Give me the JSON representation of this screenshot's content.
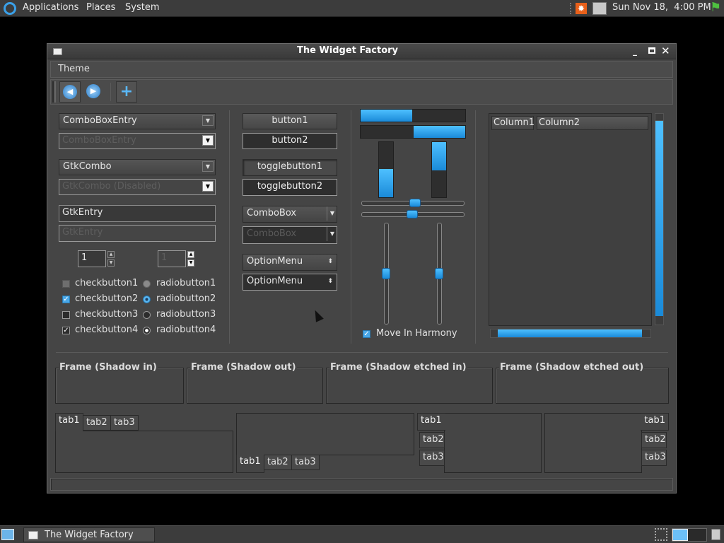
{
  "top_panel": {
    "menus": [
      "Applications",
      "Places",
      "System"
    ],
    "clock": "Sun Nov 18,  4:00 PM"
  },
  "window": {
    "title": "The Widget Factory",
    "menu": [
      "Theme"
    ],
    "combos": {
      "combo_entry": "ComboBoxEntry",
      "combo_entry_disabled": "ComboBoxEntry",
      "gtk_combo": "GtkCombo",
      "gtk_combo_disabled": "GtkCombo (Disabled)"
    },
    "entries": {
      "entry": "GtkEntry",
      "entry_disabled": "GtkEntry"
    },
    "spin_values": [
      "1",
      "1"
    ],
    "checks": [
      {
        "label": "checkbutton1",
        "state": "inconsistent"
      },
      {
        "label": "checkbutton2",
        "state": "checked-disabled"
      },
      {
        "label": "checkbutton3",
        "state": "unchecked"
      },
      {
        "label": "checkbutton4",
        "state": "checked"
      }
    ],
    "radios": [
      {
        "label": "radiobutton1",
        "state": "inconsistent"
      },
      {
        "label": "radiobutton2",
        "state": "checked-disabled"
      },
      {
        "label": "radiobutton3",
        "state": "unchecked"
      },
      {
        "label": "radiobutton4",
        "state": "checked"
      }
    ],
    "buttons": [
      "button1",
      "button2"
    ],
    "toggles": [
      "togglebutton1",
      "togglebutton2"
    ],
    "comboboxes": [
      "ComboBox",
      "ComboBox"
    ],
    "option_menus": [
      "OptionMenu",
      "OptionMenu"
    ],
    "progress": {
      "h1": 0.49,
      "h2": 0.49,
      "v1": 0.5,
      "v2": 0.5
    },
    "harmony_label": "Move In Harmony",
    "tree_columns": [
      "Column1",
      "Column2"
    ],
    "frames": [
      "Frame (Shadow in)",
      "Frame (Shadow out)",
      "Frame (Shadow etched in)",
      "Frame (Shadow etched out)"
    ],
    "tabs": [
      "tab1",
      "tab2",
      "tab3"
    ]
  },
  "bottom_panel": {
    "task": "The Widget Factory"
  },
  "colors": {
    "accent": "#2a9ae8",
    "panel": "#3c3c3c",
    "window": "#454545"
  }
}
